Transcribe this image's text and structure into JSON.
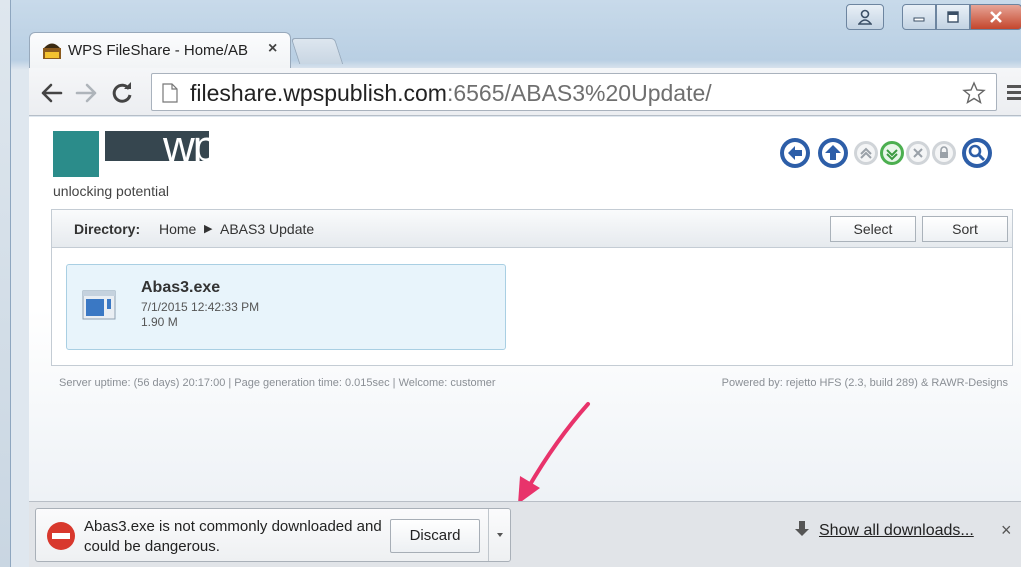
{
  "tab": {
    "title": "WPS FileShare - Home/AB",
    "close": "×"
  },
  "address": {
    "host": "fileshare.wpspublish.com",
    "rest": ":6565/ABAS3%20Update/"
  },
  "logo": {
    "wordmark": "wps",
    "tagline": "unlocking potential"
  },
  "directory": {
    "label": "Directory:",
    "crumbs": [
      "Home",
      "ABAS3 Update"
    ],
    "crumb_sep": "▶",
    "select_label": "Select",
    "sort_label": "Sort"
  },
  "file": {
    "name": "Abas3.exe",
    "date": "7/1/2015 12:42:33 PM",
    "size": "1.90 M"
  },
  "footer": {
    "left": "Server uptime:  (56 days) 20:17:00  |  Page generation time:  0.015sec  |  Welcome: customer",
    "right": "Powered by: rejetto HFS (2.3, build 289) & RAWR-Designs"
  },
  "download": {
    "warning": "Abas3.exe is not commonly downloaded and could be dangerous.",
    "discard_label": "Discard",
    "show_all_label": "Show all downloads...",
    "close": "×"
  },
  "colors": {
    "brand_teal": "#2b8c8a",
    "brand_dark": "#36464f",
    "arrow": "#e8336b",
    "danger": "#d8382d"
  },
  "icons": [
    "back-icon",
    "forward-icon",
    "reload-icon",
    "page-icon",
    "star-icon",
    "menu-icon",
    "danger-icon",
    "download-arrow-icon"
  ]
}
